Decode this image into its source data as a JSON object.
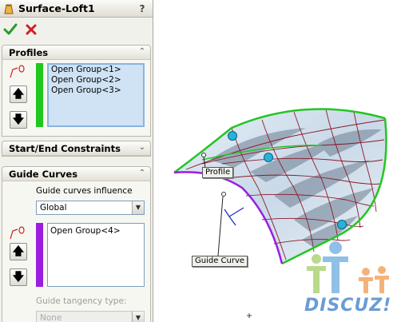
{
  "panel": {
    "title": "Surface-Loft1",
    "help_label": "?",
    "ok_icon": "check-icon",
    "cancel_icon": "x-icon",
    "colors": {
      "profile_bar": "#1ec81e",
      "guide_bar": "#9b1de0",
      "accent": "#2bb02b"
    }
  },
  "profiles": {
    "header": "Profiles",
    "items": [
      "Open Group<1>",
      "Open Group<2>",
      "Open Group<3>"
    ]
  },
  "constraints": {
    "header": "Start/End Constraints"
  },
  "guide_curves": {
    "header": "Guide Curves",
    "influence_label": "Guide curves influence",
    "influence_value": "Global",
    "items": [
      "Open Group<4>"
    ],
    "tangency_label": "Guide tangency type:",
    "tangency_value": "None"
  },
  "viewport": {
    "callout_profile": "Profile",
    "callout_guide": "Guide Curve",
    "watermark": "DISCUZ!"
  }
}
